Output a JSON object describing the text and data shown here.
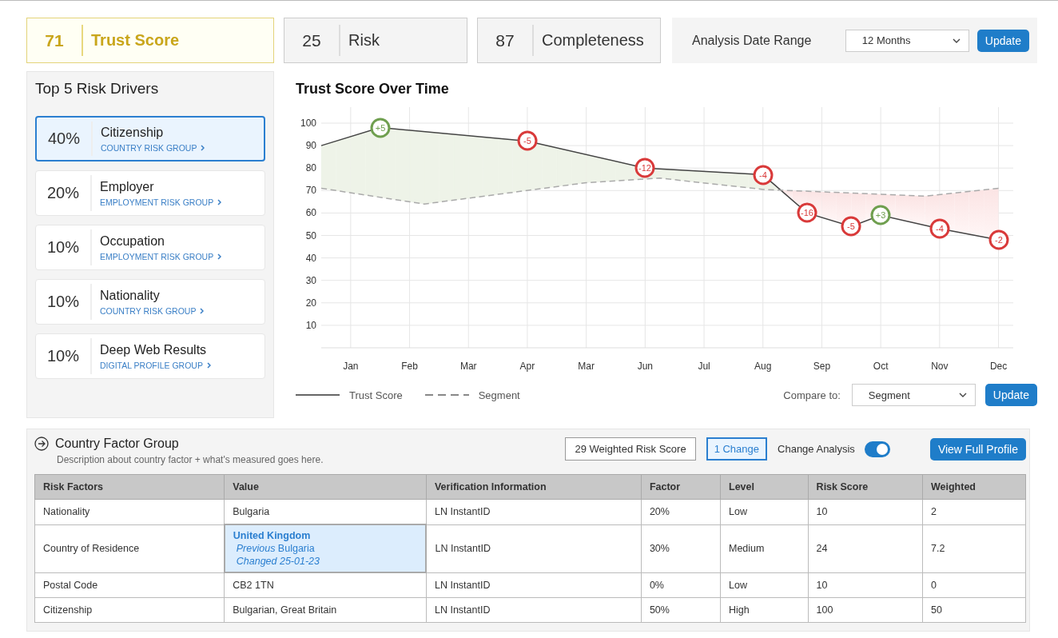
{
  "scores": [
    {
      "value": "71",
      "label": "Trust Score",
      "selected": true
    },
    {
      "value": "25",
      "label": "Risk",
      "selected": false
    },
    {
      "value": "87",
      "label": "Completeness",
      "selected": false
    }
  ],
  "date_range": {
    "label": "Analysis Date Range",
    "select": "12 Months",
    "button": "Update"
  },
  "drivers": {
    "title": "Top 5 Risk Drivers",
    "items": [
      {
        "percent": "40%",
        "name": "Citizenship",
        "group": "COUNTRY RISK GROUP",
        "selected": true
      },
      {
        "percent": "20%",
        "name": "Employer",
        "group": "EMPLOYMENT RISK GROUP",
        "selected": false
      },
      {
        "percent": "10%",
        "name": "Occupation",
        "group": "EMPLOYMENT RISK GROUP",
        "selected": false
      },
      {
        "percent": "10%",
        "name": "Nationality",
        "group": "COUNTRY RISK GROUP",
        "selected": false
      },
      {
        "percent": "10%",
        "name": "Deep Web Results",
        "group": "DIGITAL PROFILE GROUP",
        "selected": false
      }
    ]
  },
  "trend": {
    "title": "Trust Score Over Time",
    "chart_data": {
      "type": "line",
      "categories": [
        null,
        null,
        "Jan",
        null,
        null,
        null,
        "Feb",
        null,
        null,
        null,
        "Mar",
        null,
        null,
        null,
        "Apr",
        null,
        null,
        null,
        "Mar",
        null,
        null,
        null,
        "Jun",
        null,
        null,
        null,
        "Jul",
        null,
        null,
        null,
        "Aug",
        null,
        null,
        null,
        "Sep",
        null,
        null,
        null,
        "Oct",
        null,
        null,
        null,
        "Nov",
        null,
        null,
        null,
        "Dec"
      ],
      "series": [
        {
          "name": "Trust Score",
          "color": "#444444",
          "line_style": "solid",
          "marker": "circle",
          "values": [
            90,
            null,
            null,
            null,
            98,
            null,
            null,
            null,
            null,
            null,
            null,
            null,
            null,
            null,
            92,
            null,
            null,
            null,
            null,
            null,
            null,
            null,
            80,
            null,
            null,
            null,
            null,
            null,
            null,
            null,
            77,
            null,
            null,
            60,
            null,
            null,
            54,
            null,
            59,
            null,
            null,
            null,
            53,
            null,
            null,
            null,
            48
          ]
        },
        {
          "name": "Segment",
          "color": "#aaaaaa",
          "line_style": "dashed",
          "values": [
            71,
            null,
            null,
            null,
            null,
            null,
            null,
            64,
            null,
            null,
            null,
            null,
            null,
            null,
            null,
            null,
            null,
            null,
            73.5,
            null,
            null,
            null,
            null,
            75.5,
            null,
            null,
            null,
            null,
            null,
            null,
            70.5,
            null,
            null,
            null,
            null,
            null,
            null,
            null,
            null,
            null,
            null,
            67.5,
            null,
            null,
            null,
            null,
            71
          ]
        }
      ],
      "ylim": [
        0,
        100
      ],
      "grid": true,
      "yticks": [
        10,
        20,
        30,
        40,
        50,
        60,
        70,
        80,
        90,
        100
      ]
    },
    "markers": [
      {
        "text": "+5",
        "color": "#6f9f4f"
      },
      {
        "text": "-5",
        "color": "#d93a3a"
      },
      {
        "text": "-12",
        "color": "#d93a3a"
      },
      {
        "text": "-4",
        "color": "#d93a3a"
      },
      {
        "text": "-16",
        "color": "#d93a3a"
      },
      {
        "text": "-5",
        "color": "#d93a3a"
      },
      {
        "text": "+3",
        "color": "#6f9f4f"
      },
      {
        "text": "-4",
        "color": "#d93a3a"
      },
      {
        "text": "-2",
        "color": "#d93a3a"
      }
    ],
    "compare_label": "Compare to:",
    "compare_select": "Segment",
    "button": "Update"
  },
  "factor_group": {
    "title": "Country Factor Group",
    "description": "Description about country factor + what's measured goes here.",
    "badges": [
      {
        "text": "29 Weighted Risk Score",
        "selected": false
      },
      {
        "text": "1 Change",
        "selected": true
      }
    ],
    "toggle": {
      "label": "Change Analysis",
      "on": true
    },
    "button": "View Full Profile",
    "table": {
      "columns": [
        "Risk Factors",
        "Value",
        "Verification Information",
        "Factor",
        "Level",
        "Risk Score",
        "Weighted"
      ],
      "rows": [
        {
          "cells": [
            "Nationality",
            "Bulgaria",
            "LN InstantID",
            "20%",
            "Low",
            "10",
            "2"
          ]
        },
        {
          "cells": [
            "Country of Residence",
            {
              "kind": "change",
              "current": "United Kingdom",
              "previous": "*Previous* Bulgaria",
              "changed": "Changed 25-01-23"
            },
            "LN InstantID",
            "30%",
            "Medium",
            "24",
            "7.2"
          ]
        },
        {
          "cells": [
            "Postal Code",
            "CB2 1TN",
            "LN InstantID",
            "0%",
            "Low",
            "10",
            "0"
          ]
        },
        {
          "cells": [
            "Citizenship",
            "Bulgarian, Great Britain",
            "LN InstantID",
            "50%",
            "High",
            "100",
            "50"
          ]
        }
      ]
    }
  }
}
